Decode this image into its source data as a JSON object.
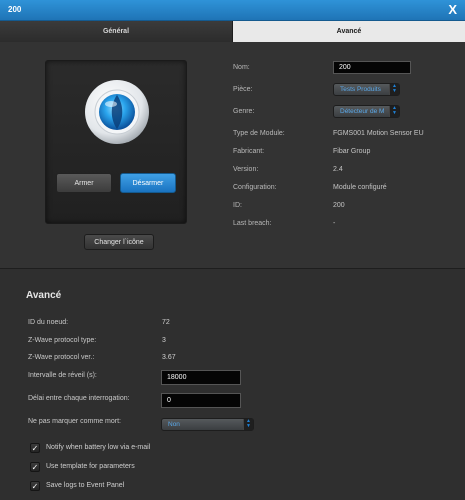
{
  "window": {
    "title": "200",
    "close_label": "X"
  },
  "tabs": [
    {
      "label": "Général",
      "active": false
    },
    {
      "label": "Avancé",
      "active": true
    }
  ],
  "device": {
    "arm_label": "Armer",
    "disarm_label": "Désarmer",
    "change_icon_label": "Changer l`icône"
  },
  "properties": {
    "name_label": "Nom:",
    "name_value": "200",
    "room_label": "Pièce:",
    "room_value": "Tests Produits",
    "genre_label": "Genre:",
    "genre_value": "Détecteur de M",
    "module_type_label": "Type de Module:",
    "module_type_value": "FGMS001 Motion Sensor EU",
    "manufacturer_label": "Fabricant:",
    "manufacturer_value": "Fibar Group",
    "version_label": "Version:",
    "version_value": "2.4",
    "configuration_label": "Configuration:",
    "configuration_value": "Module configuré",
    "id_label": "ID:",
    "id_value": "200",
    "last_breach_label": "Last breach:",
    "last_breach_value": "-"
  },
  "advanced": {
    "title": "Avancé",
    "node_id_label": "ID du noeud:",
    "node_id_value": "72",
    "zwave_type_label": "Z-Wave protocol type:",
    "zwave_type_value": "3",
    "zwave_ver_label": "Z-Wave protocol ver.:",
    "zwave_ver_value": "3.67",
    "wakeup_label": "Intervalle de réveil (s):",
    "wakeup_value": "18000",
    "poll_label": "Délai entre chaque interrogation:",
    "poll_value": "0",
    "dead_label": "Ne pas marquer comme mort:",
    "dead_value": "Non",
    "checkboxes": [
      {
        "label": "Notify when battery low via e-mail",
        "checked": true
      },
      {
        "label": "Use template for parameters",
        "checked": true
      },
      {
        "label": "Save logs to Event Panel",
        "checked": true
      }
    ]
  },
  "colors": {
    "accent": "#1f7fd0",
    "titlebar": "#2a8ad0",
    "panel": "#333333"
  }
}
